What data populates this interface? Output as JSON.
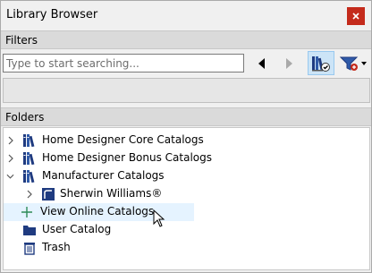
{
  "window": {
    "title": "Library Browser",
    "close_icon": "close-icon"
  },
  "filters": {
    "header": "Filters",
    "search_placeholder": "Type to start searching...",
    "back_icon": "back-arrow-icon",
    "forward_icon": "forward-arrow-icon",
    "library_filter_icon": "library-filter-icon",
    "filter_menu_icon": "filter-funnel-icon"
  },
  "folders": {
    "header": "Folders",
    "items": [
      {
        "label": "Home Designer Core Catalogs",
        "icon": "catalog-books-icon",
        "expandable": true,
        "expanded": false
      },
      {
        "label": "Home Designer Bonus Catalogs",
        "icon": "catalog-books-icon",
        "expandable": true,
        "expanded": false
      },
      {
        "label": "Manufacturer Catalogs",
        "icon": "catalog-books-icon",
        "expandable": true,
        "expanded": true
      },
      {
        "label": "Sherwin Williams®",
        "icon": "sherwin-williams-icon",
        "expandable": true,
        "expanded": false
      },
      {
        "label": "View Online Catalogs",
        "icon": "plus-icon",
        "expandable": false
      },
      {
        "label": "User Catalog",
        "icon": "folder-icon",
        "expandable": false
      },
      {
        "label": "Trash",
        "icon": "trash-icon",
        "expandable": false
      }
    ]
  },
  "colors": {
    "close_button": "#c42b1c",
    "hover_row": "#e5f3ff",
    "active_tool": "#cce4f7",
    "header_bg": "#dadada",
    "folder_blue": "#1f3b80"
  }
}
